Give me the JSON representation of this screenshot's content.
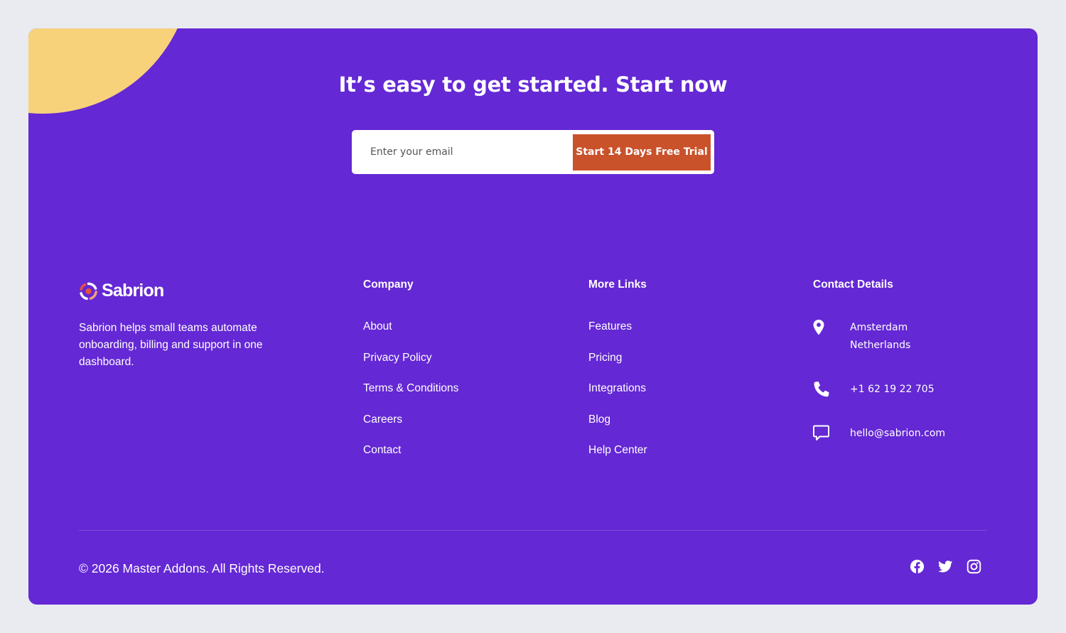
{
  "cta": {
    "headline": "It’s easy to get started. Start now",
    "email_placeholder": "Enter your email",
    "button_label": "Start 14 Days Free Trial"
  },
  "brand": {
    "name": "Sabrion",
    "description": "Sabrion helps small teams automate onboarding, billing and support in one dashboard.",
    "logo_icon": "sabrion-logo-icon"
  },
  "company": {
    "title": "Company",
    "links": [
      "About",
      "Privacy Policy",
      "Terms & Conditions",
      "Careers",
      "Contact"
    ]
  },
  "more_links": {
    "title": "More Links",
    "links": [
      "Features",
      "Pricing",
      "Integrations",
      "Blog",
      "Help Center"
    ]
  },
  "contact": {
    "title": "Contact Details",
    "address_line1": "Amsterdam",
    "address_line2": "Netherlands",
    "phone": "+1 62 19 22 705",
    "email": "hello@sabrion.com",
    "icons": [
      "location-pin-icon",
      "phone-icon",
      "chat-bubble-icon"
    ]
  },
  "footer": {
    "copyright": "© 2026 Master Addons. All Rights Reserved.",
    "social_icons": [
      "facebook-icon",
      "twitter-icon",
      "instagram-icon"
    ]
  },
  "colors": {
    "page_background": "#e9ebf0",
    "panel": "#6428d4",
    "accent_button": "#c9522b",
    "corner_blob": "#f8d27b",
    "text": "#ffffff"
  }
}
